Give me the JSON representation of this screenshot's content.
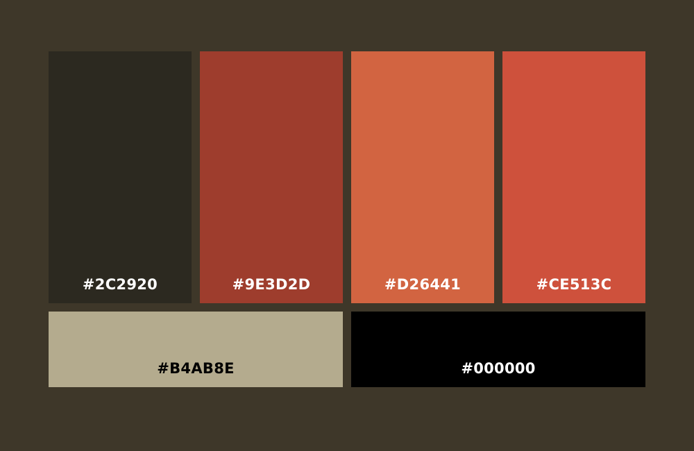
{
  "background": "#3E3729",
  "swatches": [
    {
      "label": "#2C2920",
      "color": "#2C2920",
      "text_color": "#FFFFFF"
    },
    {
      "label": "#9E3D2D",
      "color": "#9E3D2D",
      "text_color": "#FFFFFF"
    },
    {
      "label": "#D26441",
      "color": "#D26441",
      "text_color": "#FFFFFF"
    },
    {
      "label": "#CE513C",
      "color": "#CE513C",
      "text_color": "#FFFFFF"
    },
    {
      "label": "#B4AB8E",
      "color": "#B4AB8E",
      "text_color": "#000000"
    },
    {
      "label": "#000000",
      "color": "#000000",
      "text_color": "#FFFFFF"
    }
  ]
}
